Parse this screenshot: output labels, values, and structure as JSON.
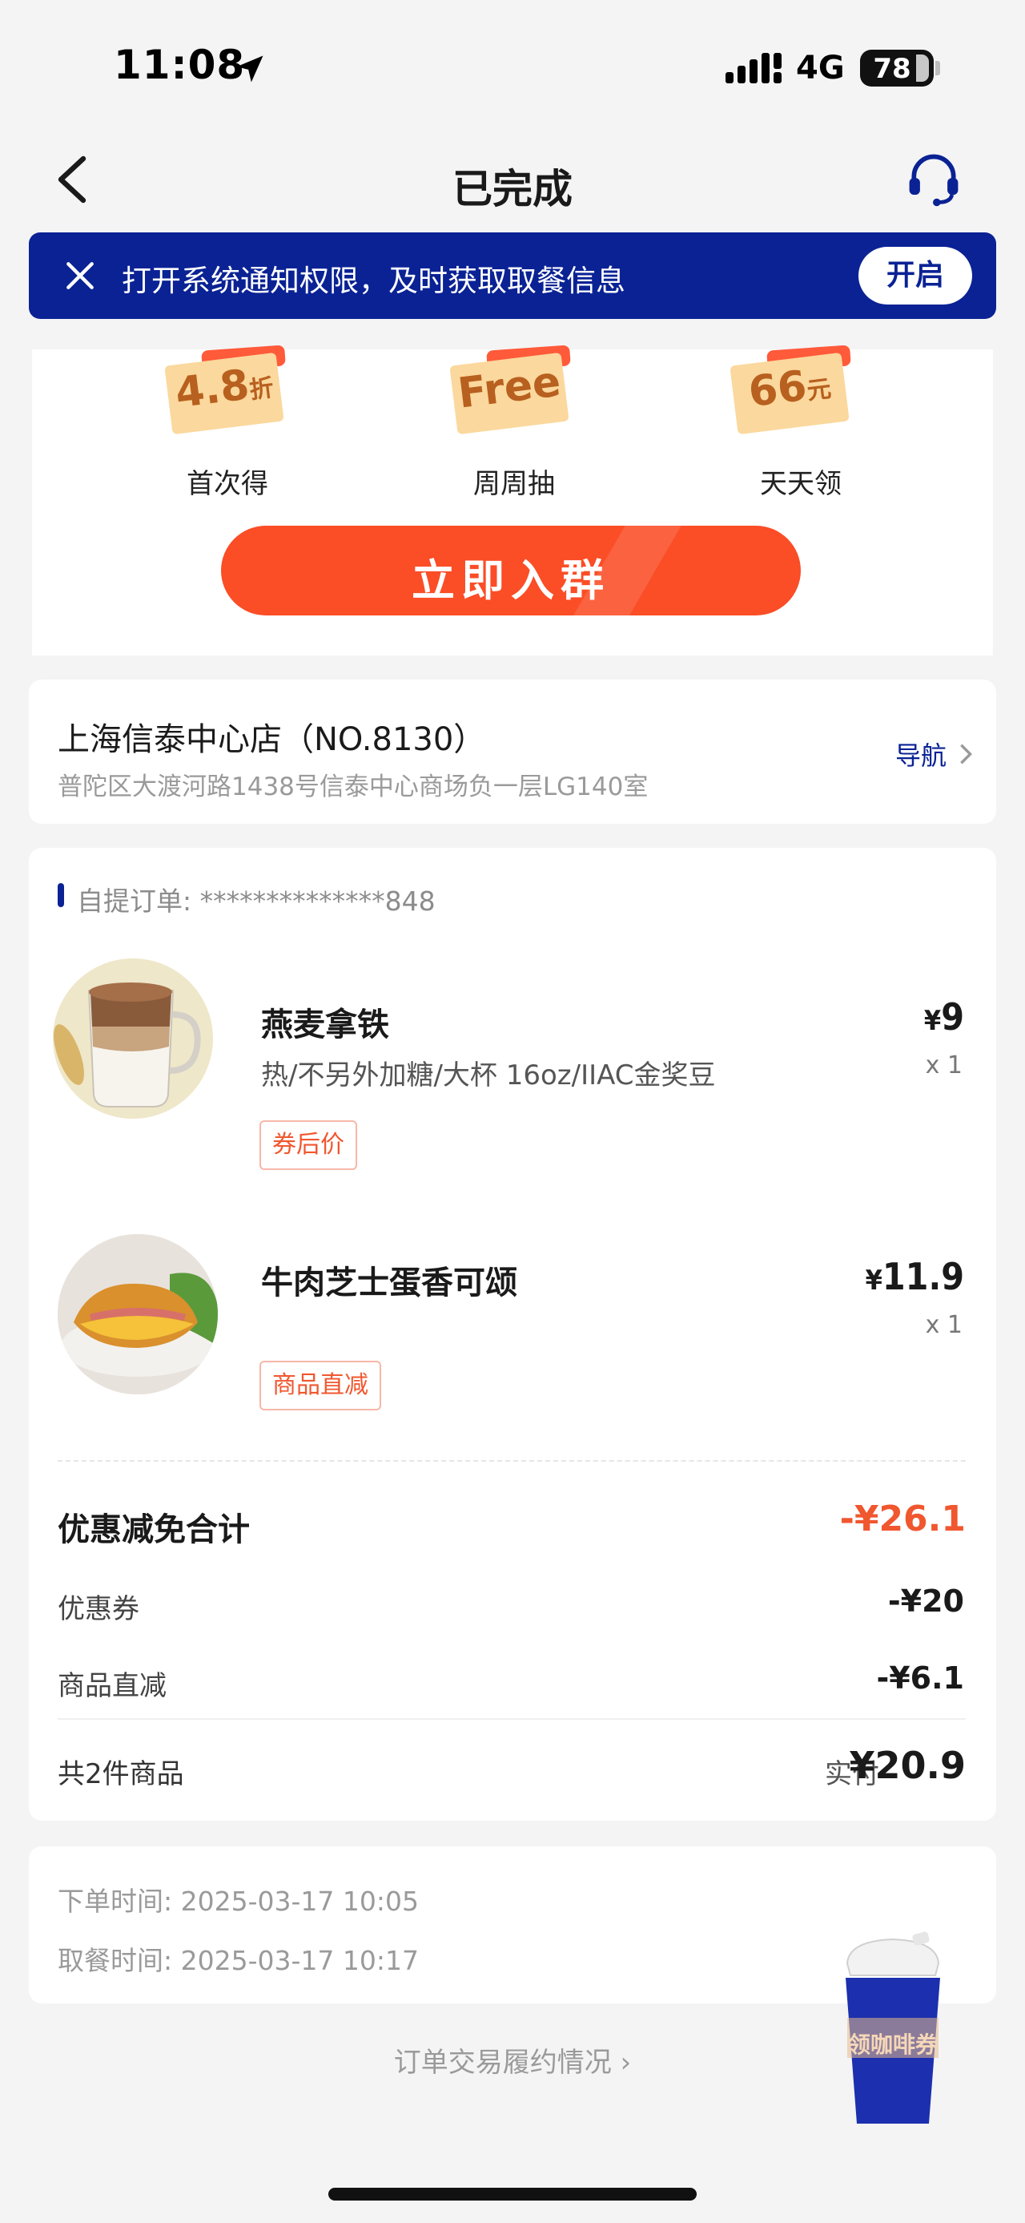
{
  "status_bar": {
    "time": "11:08",
    "network": "4G",
    "battery": "78"
  },
  "nav": {
    "title": "已完成"
  },
  "notice": {
    "text": "打开系统通知权限，及时获取取餐信息",
    "button": "开启"
  },
  "promo": {
    "coupons": [
      {
        "value": "4.8",
        "unit": "折",
        "label": "首次得"
      },
      {
        "value": "Free",
        "unit": "",
        "label": "周周抽"
      },
      {
        "value": "66",
        "unit": "元",
        "label": "天天领"
      }
    ],
    "join_button": "立即入群"
  },
  "store": {
    "name": "上海信泰中心店（NO.8130）",
    "address": "普陀区大渡河路1438号信泰中心商场负一层LG140室",
    "nav_label": "导航"
  },
  "order": {
    "number_label": "自提订单: **************848",
    "items": [
      {
        "name": "燕麦拿铁",
        "spec": "热/不另外加糖/大杯 16oz/IIAC金奖豆",
        "tag": "券后价",
        "currency": "¥",
        "price": "9",
        "qty": "x 1"
      },
      {
        "name": "牛肉芝士蛋香可颂",
        "spec": "",
        "tag": "商品直减",
        "currency": "¥",
        "price": "11.9",
        "qty": "x 1"
      }
    ],
    "discount": {
      "title": "优惠减免合计",
      "total": "-¥26.1",
      "rows": [
        {
          "label": "优惠券",
          "value": "-¥20"
        },
        {
          "label": "商品直减",
          "value": "-¥6.1"
        }
      ]
    },
    "count_label": "共2件商品",
    "paid_label": "实付",
    "paid_value": "¥20.9"
  },
  "times": {
    "order_time": "下单时间:  2025-03-17 10:05",
    "pickup_time": "取餐时间:  2025-03-17 10:17"
  },
  "footer": {
    "link": "订单交易履约情况 ›"
  },
  "floating": {
    "cup_label": "领咖啡券"
  },
  "colors": {
    "brand_blue": "#0a2294",
    "accent_orange": "#fb4d26",
    "discount_red": "#f0572f"
  }
}
